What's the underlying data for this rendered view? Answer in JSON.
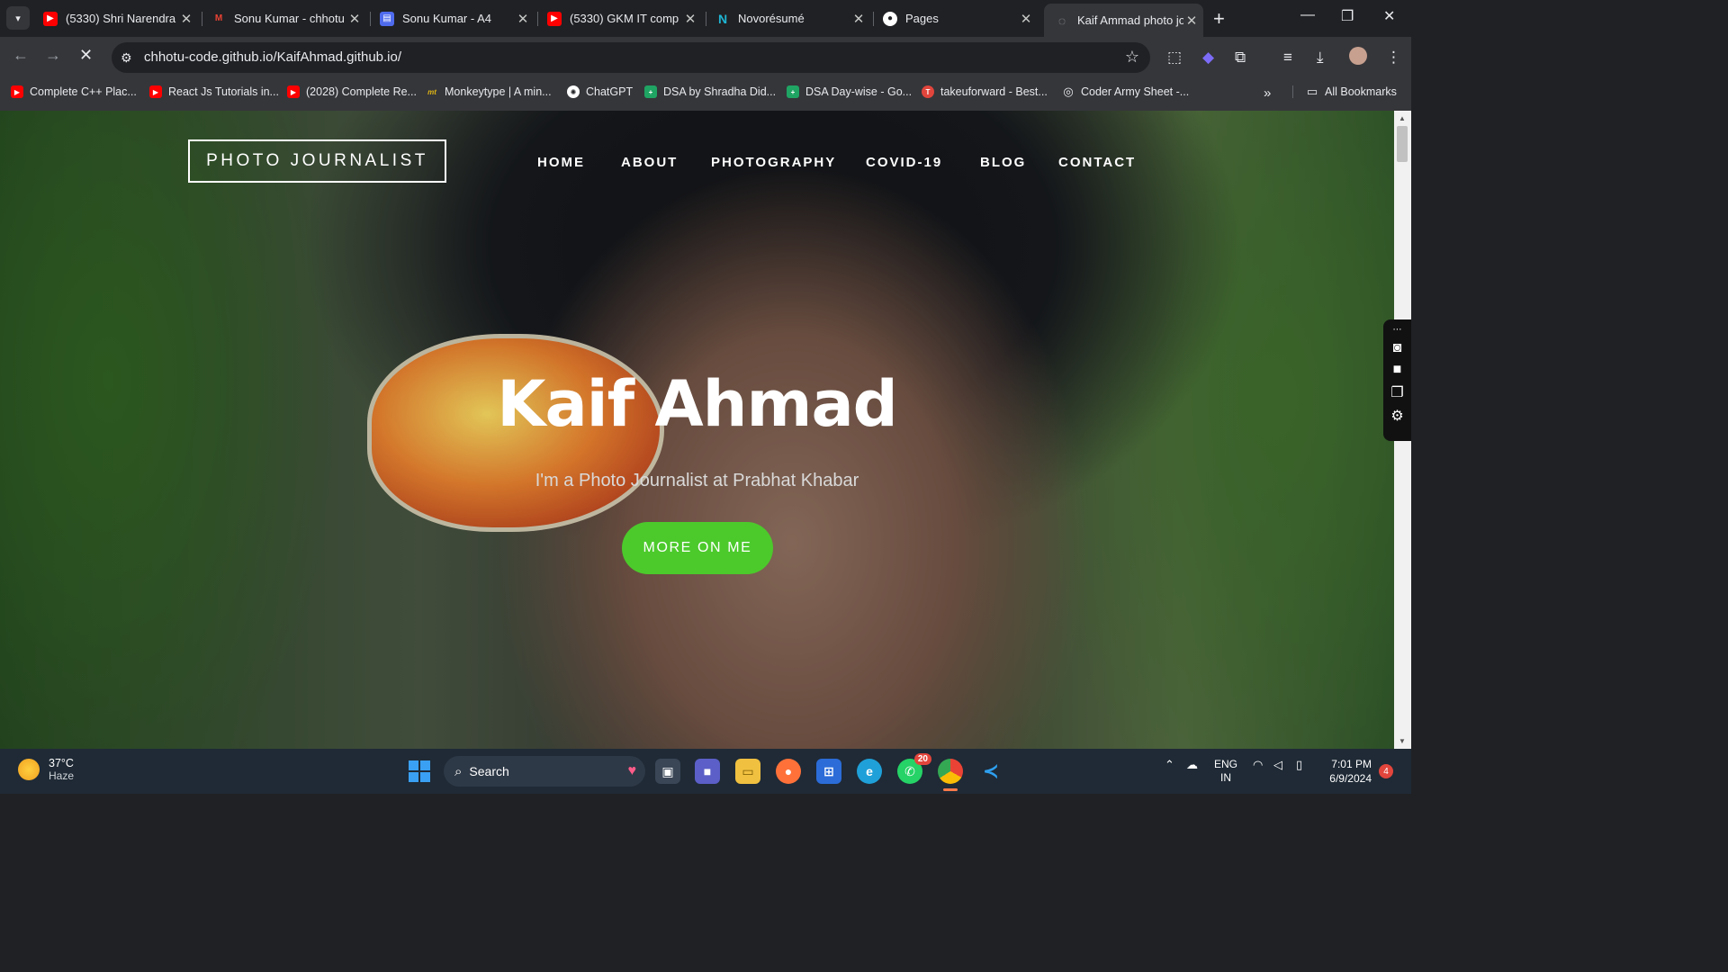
{
  "browser": {
    "tabs": [
      {
        "title": "(5330) Shri Narendra",
        "icon": "youtube-icon",
        "color": "#ff0000"
      },
      {
        "title": "Sonu Kumar - chhotu",
        "icon": "gmail-icon",
        "color": "#ea4335"
      },
      {
        "title": "Sonu Kumar - A4",
        "icon": "doc-icon",
        "color": "#4f6bed"
      },
      {
        "title": "(5330) GKM IT comp",
        "icon": "youtube-icon",
        "color": "#ff0000"
      },
      {
        "title": "Novorésumé",
        "icon": "novoresume-icon",
        "color": "#1fb6d5"
      },
      {
        "title": "Pages",
        "icon": "github-icon",
        "color": "#ffffff"
      },
      {
        "title": "Kaif Ammad photo jo",
        "icon": "loading-icon",
        "color": "#9aa0a6"
      }
    ],
    "url": "chhotu-code.github.io/KaifAhmad.github.io/",
    "bookmarks": [
      {
        "label": "Complete C++ Plac...",
        "icon": "youtube-icon"
      },
      {
        "label": "React Js Tutorials in...",
        "icon": "youtube-icon"
      },
      {
        "label": "(2028) Complete Re...",
        "icon": "youtube-icon"
      },
      {
        "label": "Monkeytype | A min...",
        "icon": "monkeytype-icon"
      },
      {
        "label": "ChatGPT",
        "icon": "chatgpt-icon"
      },
      {
        "label": "DSA by Shradha Did...",
        "icon": "sheets-icon"
      },
      {
        "label": "DSA Day-wise - Go...",
        "icon": "sheets-icon"
      },
      {
        "label": "takeuforward - Best...",
        "icon": "tuf-icon"
      },
      {
        "label": "Coder Army Sheet -...",
        "icon": "globe-icon"
      }
    ],
    "all_bookmarks_label": "All Bookmarks"
  },
  "site": {
    "brand": "PHOTO JOURNALIST",
    "nav": [
      "HOME",
      "ABOUT",
      "PHOTOGRAPHY",
      "COVID-19",
      "BLOG",
      "CONTACT"
    ],
    "hero_name": "Kaif Ahmad",
    "hero_subtitle": "I'm a Photo Journalist at Prabhat Khabar",
    "cta_label": "MORE ON ME",
    "accent_color": "#4cca2c"
  },
  "taskbar": {
    "temperature": "37°C",
    "weather": "Haze",
    "search_label": "Search",
    "whatsapp_badge": "20",
    "language": "ENG",
    "region": "IN",
    "time": "7:01 PM",
    "date": "6/9/2024",
    "notifications": "4"
  }
}
